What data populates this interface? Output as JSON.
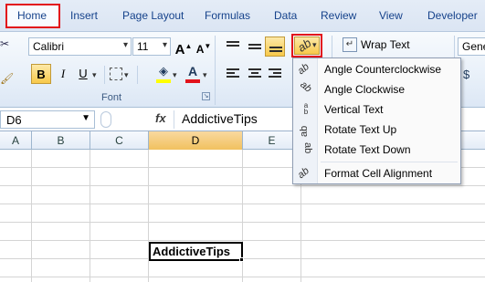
{
  "tabs": [
    "Home",
    "Insert",
    "Page Layout",
    "Formulas",
    "Data",
    "Review",
    "View",
    "Developer"
  ],
  "font": {
    "name": "Calibri",
    "size": "11",
    "grow_label": "A",
    "shrink_label": "A",
    "bold": "B",
    "italic": "I",
    "underline": "U",
    "font_color_label": "A",
    "group_label": "Font"
  },
  "alignment": {
    "wrap_text_label": "Wrap Text"
  },
  "number": {
    "format_label": "Gene"
  },
  "formula_bar": {
    "name_box": "D6",
    "fx_label": "fx",
    "formula_value": "AddictiveTips"
  },
  "columns": [
    "A",
    "B",
    "C",
    "D",
    "E"
  ],
  "selected_column": "D",
  "active_cell": {
    "ref": "D6",
    "value": "AddictiveTips"
  },
  "orientation_menu": {
    "items": [
      "Angle Counterclockwise",
      "Angle Clockwise",
      "Vertical Text",
      "Rotate Text Up",
      "Rotate Text Down",
      "Format Cell Alignment"
    ]
  },
  "colors": {
    "highlight_red": "#e2121b",
    "font_color": "#e2121b",
    "fill_color": "#ffff00",
    "selected_header": "#f1c15f"
  }
}
